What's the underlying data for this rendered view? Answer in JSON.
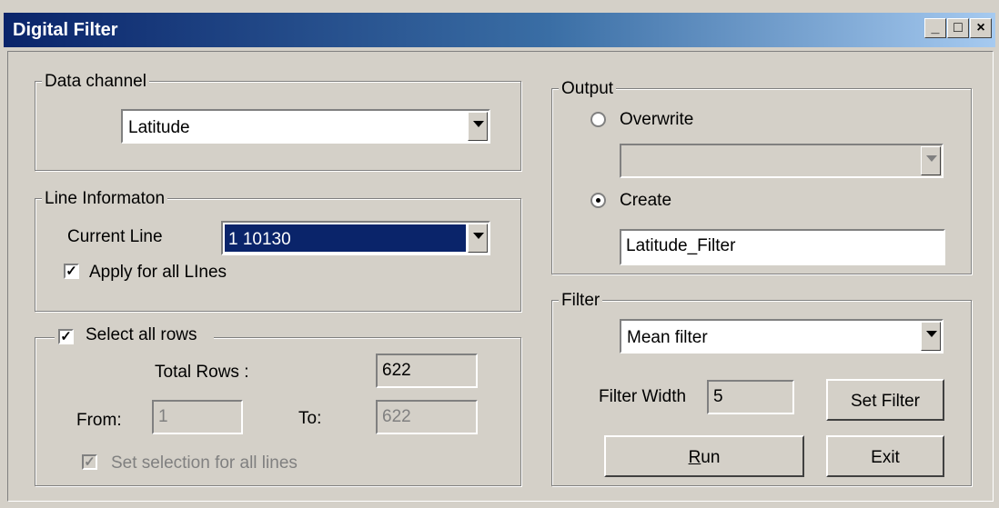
{
  "window": {
    "title": "Digital Filter",
    "minimize": "_",
    "maximize": "□",
    "close": "×"
  },
  "data_channel": {
    "legend": "Data channel",
    "selected": "Latitude"
  },
  "line_info": {
    "legend": "Line Informaton",
    "current_line_label": "Current Line",
    "current_line_value": "1   10130",
    "apply_all_label": "Apply for all LInes",
    "apply_all_checked": true
  },
  "rows": {
    "legend": "Select all rows",
    "select_all_checked": true,
    "total_rows_label": "Total Rows :",
    "total_rows_value": "622",
    "from_label": "From:",
    "from_value": "1",
    "to_label": "To:",
    "to_value": "622",
    "set_selection_label": "Set selection for all lines",
    "set_selection_checked": true
  },
  "output": {
    "legend": "Output",
    "overwrite_label": "Overwrite",
    "overwrite_selected": false,
    "overwrite_value": "",
    "create_label": "Create",
    "create_selected": true,
    "create_value": "Latitude_Filter"
  },
  "filter": {
    "legend": "Filter",
    "selected": "Mean filter",
    "width_label": "Filter Width",
    "width_value": "5",
    "set_filter_label": "Set Filter",
    "run_label": "Run",
    "run_mnemonic": "R",
    "exit_label": "Exit"
  },
  "icons": {
    "dropdown": "chevron-down-icon",
    "check": "check-icon"
  }
}
